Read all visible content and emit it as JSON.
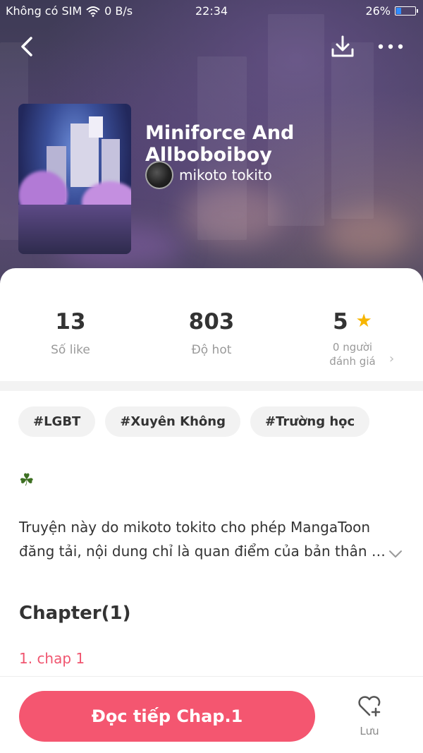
{
  "status_bar": {
    "carrier": "Không có SIM",
    "network_speed": "0 B/s",
    "time": "22:34",
    "battery": "26%",
    "battery_level": 0.26
  },
  "nav": {
    "back_icon": "chevron-left-icon",
    "download_icon": "download-icon",
    "more_icon": "more-horizontal-icon"
  },
  "book": {
    "title": "Miniforce And Allboboiboy",
    "author": "mikoto tokito"
  },
  "stats": {
    "likes": {
      "value": "13",
      "label": "Số like"
    },
    "hot": {
      "value": "803",
      "label": "Độ hot"
    },
    "rating": {
      "value": "5",
      "label_line1": "0 người",
      "label_line2": "đánh giá"
    }
  },
  "tags": [
    "#LGBT",
    "#Xuyên Không",
    "#Trường học"
  ],
  "description": {
    "icon": "clover-icon",
    "line1": "Truyện này do mikoto tokito cho phép MangaToon",
    "line2": "đăng tải, nội dung chỉ là quan điểm của bản thân …"
  },
  "chapters": {
    "heading": "Chapter(1)",
    "items": [
      "1. chap 1"
    ]
  },
  "bottom": {
    "read_label": "Đọc tiếp Chap.1",
    "save_label": "Lưu"
  },
  "colors": {
    "accent": "#f45670",
    "star": "#f7b500",
    "chapter_link": "#f0556f"
  }
}
